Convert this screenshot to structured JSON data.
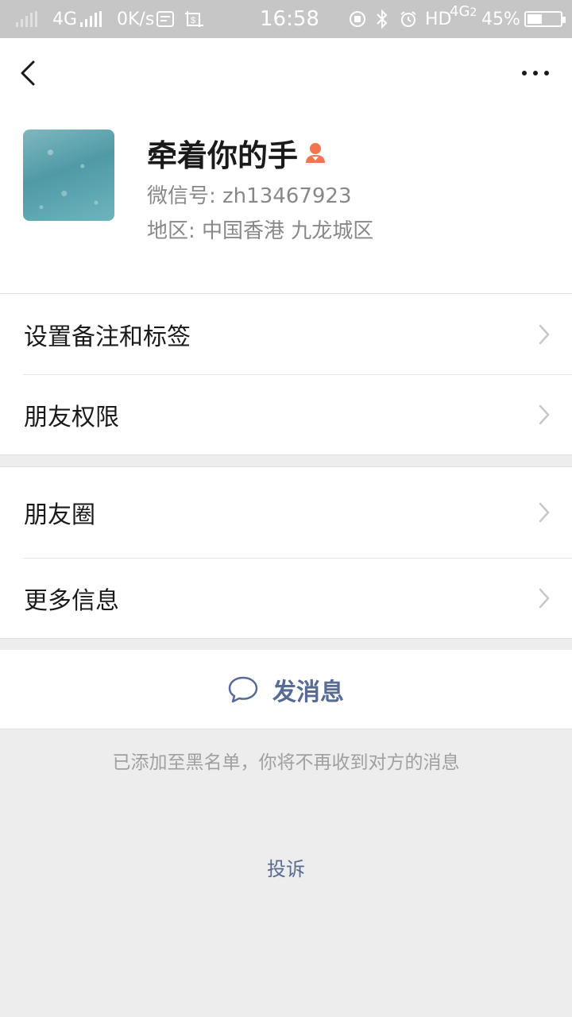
{
  "status_bar": {
    "network_type": "4G",
    "speed": "0K/s",
    "time": "16:58",
    "hd_label": "HD",
    "network2": "4G",
    "network2_sub": "2",
    "battery": "45%",
    "battery_level": 0.45
  },
  "header": {
    "back_icon": "chevron-left-icon",
    "more_icon": "more-dots-icon"
  },
  "profile": {
    "name": "牵着你的手",
    "gender_icon": "female-icon",
    "gender_color": "#f0764f",
    "wechat_id": "微信号: zh13467923",
    "region": "地区: 中国香港  九龙城区"
  },
  "group1": {
    "items": [
      {
        "label": "设置备注和标签"
      },
      {
        "label": "朋友权限"
      }
    ]
  },
  "group2": {
    "items": [
      {
        "label": "朋友圈"
      },
      {
        "label": "更多信息"
      }
    ]
  },
  "send_message": {
    "label": "发消息",
    "icon": "chat-bubble-icon"
  },
  "blacklist_note": "已添加至黑名单，你将不再收到对方的消息",
  "complaint": "投诉",
  "colors": {
    "link": "#576b95",
    "background": "#ededed",
    "status_bar": "#c6c6c6"
  }
}
